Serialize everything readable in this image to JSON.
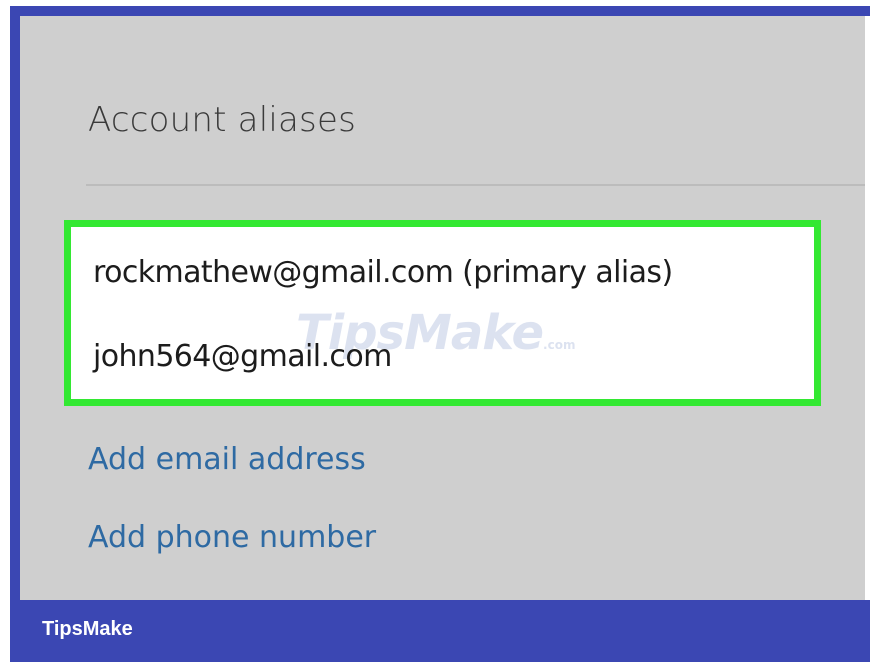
{
  "section": {
    "title": "Account aliases"
  },
  "aliases": {
    "items": [
      "rockmathew@gmail.com (primary alias)",
      "john564@gmail.com"
    ]
  },
  "actions": {
    "add_email_label": "Add email address",
    "add_phone_label": "Add phone number"
  },
  "watermark": {
    "text": "TipsMake",
    "suffix": ".com"
  },
  "footer": {
    "brand": "TipsMake"
  },
  "colors": {
    "frame_blue": "#3b47b3",
    "panel_gray": "#cfcfcf",
    "highlight_green": "#33e832",
    "link_blue": "#2e6aa3"
  }
}
